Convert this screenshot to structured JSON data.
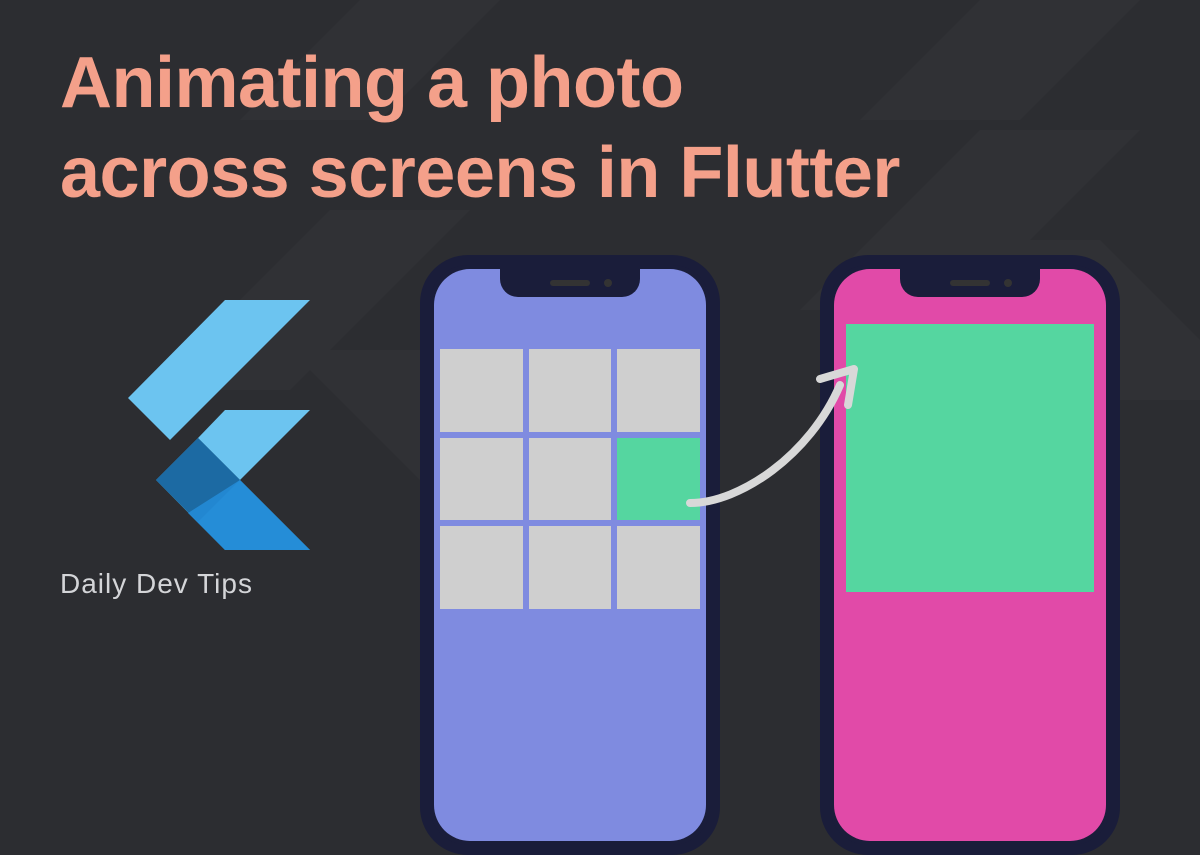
{
  "title": "Animating a photo\nacross screens in Flutter",
  "footer": "Daily Dev Tips",
  "colors": {
    "background": "#2c2d31",
    "title": "#f4a08a",
    "phone_frame": "#1a1d3a",
    "screen_a": "#7f8be0",
    "screen_b": "#e14aa8",
    "cell": "#cfcfcf",
    "accent_green": "#55d6a0",
    "flutter_light": "#6cc4f0",
    "flutter_mid": "#3aa4dd",
    "flutter_dark": "#1c6aa3"
  },
  "illustration": {
    "grid_columns": 3,
    "grid_rows": 3,
    "highlighted_cell_index": 5
  }
}
